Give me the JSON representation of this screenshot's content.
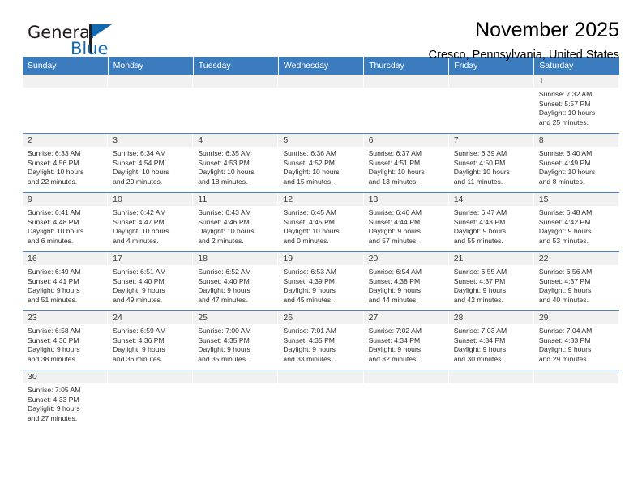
{
  "brand": {
    "name_top": "General",
    "name_bottom": "Blue",
    "accent_color": "#1269b0",
    "flag_icon": "triangle-flag-icon"
  },
  "header": {
    "title": "November 2025",
    "subtitle": "Cresco, Pennsylvania, United States"
  },
  "theme": {
    "header_bg": "#3b7cbf",
    "header_text": "#ffffff",
    "row_divider": "#4a82bd",
    "daynum_strip_bg": "#f1f1f1",
    "body_text": "#2b2b2b"
  },
  "weekday_headers": [
    "Sunday",
    "Monday",
    "Tuesday",
    "Wednesday",
    "Thursday",
    "Friday",
    "Saturday"
  ],
  "labels": {
    "sunrise_prefix": "Sunrise:",
    "sunset_prefix": "Sunset:",
    "daylight_prefix": "Daylight:"
  },
  "weeks": [
    [
      {
        "empty": true
      },
      {
        "empty": true
      },
      {
        "empty": true
      },
      {
        "empty": true
      },
      {
        "empty": true
      },
      {
        "empty": true
      },
      {
        "day": "1",
        "sunrise": "Sunrise: 7:32 AM",
        "sunset": "Sunset: 5:57 PM",
        "daylight_1": "Daylight: 10 hours",
        "daylight_2": "and 25 minutes."
      }
    ],
    [
      {
        "day": "2",
        "sunrise": "Sunrise: 6:33 AM",
        "sunset": "Sunset: 4:56 PM",
        "daylight_1": "Daylight: 10 hours",
        "daylight_2": "and 22 minutes."
      },
      {
        "day": "3",
        "sunrise": "Sunrise: 6:34 AM",
        "sunset": "Sunset: 4:54 PM",
        "daylight_1": "Daylight: 10 hours",
        "daylight_2": "and 20 minutes."
      },
      {
        "day": "4",
        "sunrise": "Sunrise: 6:35 AM",
        "sunset": "Sunset: 4:53 PM",
        "daylight_1": "Daylight: 10 hours",
        "daylight_2": "and 18 minutes."
      },
      {
        "day": "5",
        "sunrise": "Sunrise: 6:36 AM",
        "sunset": "Sunset: 4:52 PM",
        "daylight_1": "Daylight: 10 hours",
        "daylight_2": "and 15 minutes."
      },
      {
        "day": "6",
        "sunrise": "Sunrise: 6:37 AM",
        "sunset": "Sunset: 4:51 PM",
        "daylight_1": "Daylight: 10 hours",
        "daylight_2": "and 13 minutes."
      },
      {
        "day": "7",
        "sunrise": "Sunrise: 6:39 AM",
        "sunset": "Sunset: 4:50 PM",
        "daylight_1": "Daylight: 10 hours",
        "daylight_2": "and 11 minutes."
      },
      {
        "day": "8",
        "sunrise": "Sunrise: 6:40 AM",
        "sunset": "Sunset: 4:49 PM",
        "daylight_1": "Daylight: 10 hours",
        "daylight_2": "and 8 minutes."
      }
    ],
    [
      {
        "day": "9",
        "sunrise": "Sunrise: 6:41 AM",
        "sunset": "Sunset: 4:48 PM",
        "daylight_1": "Daylight: 10 hours",
        "daylight_2": "and 6 minutes."
      },
      {
        "day": "10",
        "sunrise": "Sunrise: 6:42 AM",
        "sunset": "Sunset: 4:47 PM",
        "daylight_1": "Daylight: 10 hours",
        "daylight_2": "and 4 minutes."
      },
      {
        "day": "11",
        "sunrise": "Sunrise: 6:43 AM",
        "sunset": "Sunset: 4:46 PM",
        "daylight_1": "Daylight: 10 hours",
        "daylight_2": "and 2 minutes."
      },
      {
        "day": "12",
        "sunrise": "Sunrise: 6:45 AM",
        "sunset": "Sunset: 4:45 PM",
        "daylight_1": "Daylight: 10 hours",
        "daylight_2": "and 0 minutes."
      },
      {
        "day": "13",
        "sunrise": "Sunrise: 6:46 AM",
        "sunset": "Sunset: 4:44 PM",
        "daylight_1": "Daylight: 9 hours",
        "daylight_2": "and 57 minutes."
      },
      {
        "day": "14",
        "sunrise": "Sunrise: 6:47 AM",
        "sunset": "Sunset: 4:43 PM",
        "daylight_1": "Daylight: 9 hours",
        "daylight_2": "and 55 minutes."
      },
      {
        "day": "15",
        "sunrise": "Sunrise: 6:48 AM",
        "sunset": "Sunset: 4:42 PM",
        "daylight_1": "Daylight: 9 hours",
        "daylight_2": "and 53 minutes."
      }
    ],
    [
      {
        "day": "16",
        "sunrise": "Sunrise: 6:49 AM",
        "sunset": "Sunset: 4:41 PM",
        "daylight_1": "Daylight: 9 hours",
        "daylight_2": "and 51 minutes."
      },
      {
        "day": "17",
        "sunrise": "Sunrise: 6:51 AM",
        "sunset": "Sunset: 4:40 PM",
        "daylight_1": "Daylight: 9 hours",
        "daylight_2": "and 49 minutes."
      },
      {
        "day": "18",
        "sunrise": "Sunrise: 6:52 AM",
        "sunset": "Sunset: 4:40 PM",
        "daylight_1": "Daylight: 9 hours",
        "daylight_2": "and 47 minutes."
      },
      {
        "day": "19",
        "sunrise": "Sunrise: 6:53 AM",
        "sunset": "Sunset: 4:39 PM",
        "daylight_1": "Daylight: 9 hours",
        "daylight_2": "and 45 minutes."
      },
      {
        "day": "20",
        "sunrise": "Sunrise: 6:54 AM",
        "sunset": "Sunset: 4:38 PM",
        "daylight_1": "Daylight: 9 hours",
        "daylight_2": "and 44 minutes."
      },
      {
        "day": "21",
        "sunrise": "Sunrise: 6:55 AM",
        "sunset": "Sunset: 4:37 PM",
        "daylight_1": "Daylight: 9 hours",
        "daylight_2": "and 42 minutes."
      },
      {
        "day": "22",
        "sunrise": "Sunrise: 6:56 AM",
        "sunset": "Sunset: 4:37 PM",
        "daylight_1": "Daylight: 9 hours",
        "daylight_2": "and 40 minutes."
      }
    ],
    [
      {
        "day": "23",
        "sunrise": "Sunrise: 6:58 AM",
        "sunset": "Sunset: 4:36 PM",
        "daylight_1": "Daylight: 9 hours",
        "daylight_2": "and 38 minutes."
      },
      {
        "day": "24",
        "sunrise": "Sunrise: 6:59 AM",
        "sunset": "Sunset: 4:36 PM",
        "daylight_1": "Daylight: 9 hours",
        "daylight_2": "and 36 minutes."
      },
      {
        "day": "25",
        "sunrise": "Sunrise: 7:00 AM",
        "sunset": "Sunset: 4:35 PM",
        "daylight_1": "Daylight: 9 hours",
        "daylight_2": "and 35 minutes."
      },
      {
        "day": "26",
        "sunrise": "Sunrise: 7:01 AM",
        "sunset": "Sunset: 4:35 PM",
        "daylight_1": "Daylight: 9 hours",
        "daylight_2": "and 33 minutes."
      },
      {
        "day": "27",
        "sunrise": "Sunrise: 7:02 AM",
        "sunset": "Sunset: 4:34 PM",
        "daylight_1": "Daylight: 9 hours",
        "daylight_2": "and 32 minutes."
      },
      {
        "day": "28",
        "sunrise": "Sunrise: 7:03 AM",
        "sunset": "Sunset: 4:34 PM",
        "daylight_1": "Daylight: 9 hours",
        "daylight_2": "and 30 minutes."
      },
      {
        "day": "29",
        "sunrise": "Sunrise: 7:04 AM",
        "sunset": "Sunset: 4:33 PM",
        "daylight_1": "Daylight: 9 hours",
        "daylight_2": "and 29 minutes."
      }
    ],
    [
      {
        "day": "30",
        "sunrise": "Sunrise: 7:05 AM",
        "sunset": "Sunset: 4:33 PM",
        "daylight_1": "Daylight: 9 hours",
        "daylight_2": "and 27 minutes."
      },
      {
        "empty": true
      },
      {
        "empty": true
      },
      {
        "empty": true
      },
      {
        "empty": true
      },
      {
        "empty": true
      },
      {
        "empty": true
      }
    ]
  ]
}
